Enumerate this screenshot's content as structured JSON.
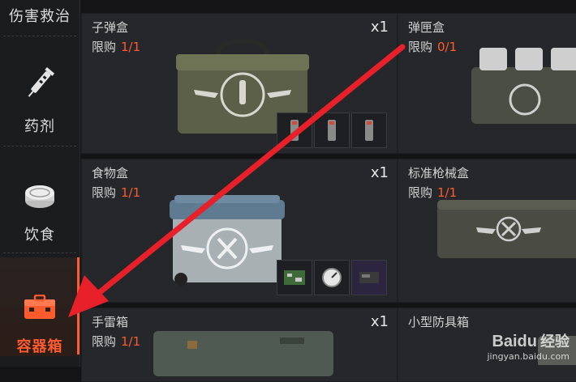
{
  "sidebar": {
    "items": [
      {
        "label": "伤害救治",
        "icon": "bandage-icon",
        "active": false
      },
      {
        "label": "药剂",
        "icon": "syringe-icon",
        "active": false
      },
      {
        "label": "饮食",
        "icon": "canned-food-icon",
        "active": false
      },
      {
        "label": "容器箱",
        "icon": "container-box-icon",
        "active": true
      }
    ]
  },
  "items": [
    {
      "name": "子弹盒",
      "limit_label": "限购",
      "limit_value": "1/1",
      "quantity": "x1"
    },
    {
      "name": "弹匣盒",
      "limit_label": "限购",
      "limit_value": "0/1",
      "quantity": ""
    },
    {
      "name": "食物盒",
      "limit_label": "限购",
      "limit_value": "1/1",
      "quantity": "x1"
    },
    {
      "name": "标准枪械盒",
      "limit_label": "限购",
      "limit_value": "1/1",
      "quantity": ""
    },
    {
      "name": "手雷箱",
      "limit_label": "限购",
      "limit_value": "1/1",
      "quantity": "x1"
    },
    {
      "name": "小型防具箱",
      "limit_label": "",
      "limit_value": "",
      "quantity": ""
    }
  ],
  "watermark": {
    "brand": "Baidu",
    "brand_cn": "经验",
    "url": "jingyan.baidu.com"
  },
  "colors": {
    "accent": "#ff5b2e",
    "arrow": "#e8202a",
    "card_bg": "#26272a"
  }
}
